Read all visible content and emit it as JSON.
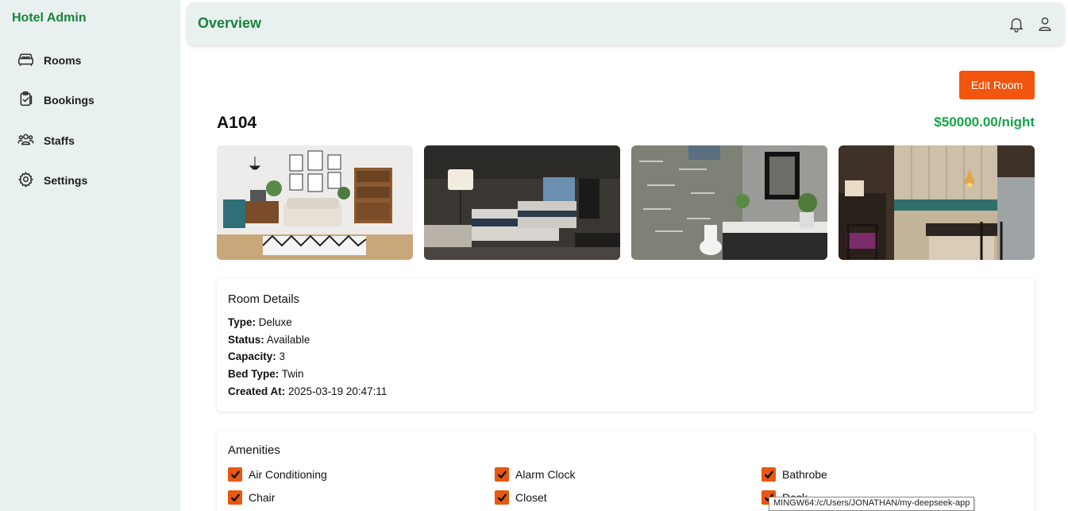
{
  "sidebar": {
    "brand": "Hotel Admin",
    "items": [
      {
        "label": "Rooms",
        "icon": "bed-icon"
      },
      {
        "label": "Bookings",
        "icon": "clipboard-check-icon"
      },
      {
        "label": "Staffs",
        "icon": "users-icon"
      },
      {
        "label": "Settings",
        "icon": "gear-icon"
      }
    ]
  },
  "header": {
    "title": "Overview",
    "icons": [
      "bell-icon",
      "user-icon"
    ]
  },
  "room": {
    "edit_label": "Edit Room",
    "name": "A104",
    "price": "$50000.00/night",
    "details_title": "Room Details",
    "details": [
      {
        "label": "Type:",
        "value": "Deluxe"
      },
      {
        "label": "Status:",
        "value": "Available"
      },
      {
        "label": "Capacity:",
        "value": "3"
      },
      {
        "label": "Bed Type:",
        "value": "Twin"
      },
      {
        "label": "Created At:",
        "value": "2025-03-19 20:47:11"
      }
    ],
    "amenities_title": "Amenities",
    "amenities": [
      {
        "label": "Air Conditioning",
        "checked": true
      },
      {
        "label": "Alarm Clock",
        "checked": true
      },
      {
        "label": "Bathrobe",
        "checked": true
      },
      {
        "label": "Chair",
        "checked": true
      },
      {
        "label": "Closet",
        "checked": true
      },
      {
        "label": "Desk",
        "checked": true
      }
    ]
  },
  "tooltip": "MINGW64:/c/Users/JONATHAN/my-deepseek-app",
  "colors": {
    "brand_green": "#16833a",
    "price_green": "#16a34a",
    "accent_orange": "#f2550d",
    "sidebar_bg": "#e9f1f0"
  }
}
